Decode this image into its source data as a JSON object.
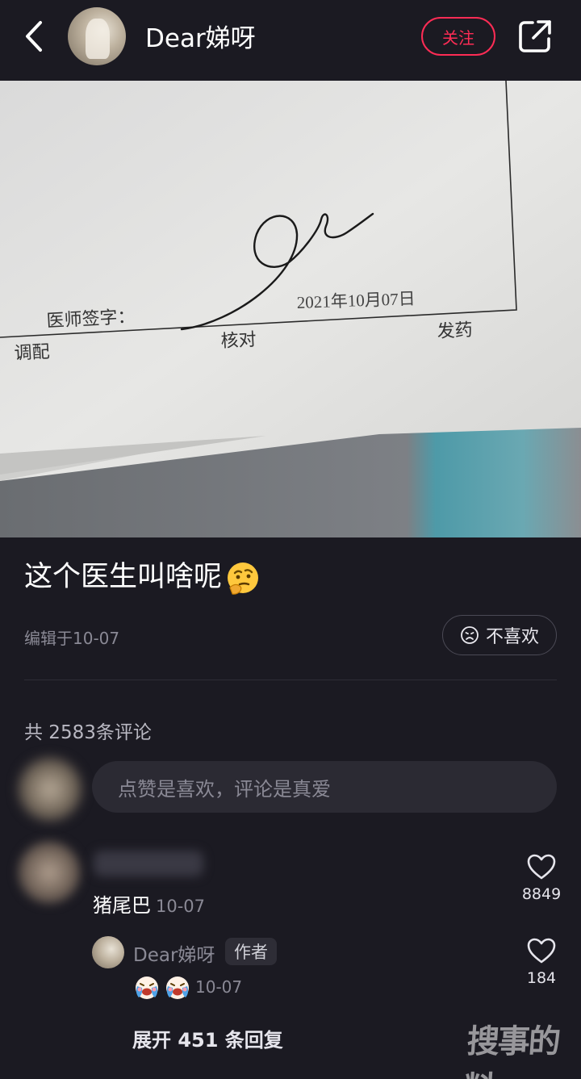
{
  "header": {
    "username": "Dear娣呀",
    "follow_label": "关注"
  },
  "photo": {
    "printed_date": "2021年10月07日",
    "label_signature": "医师签字：",
    "label_dispense": "调配",
    "label_check": "核对",
    "label_issue": "发药"
  },
  "post": {
    "title": "这个医生叫啥呢",
    "edited": "编辑于10-07",
    "dislike_label": "不喜欢"
  },
  "comments": {
    "count_label": "共 2583条评论",
    "input_placeholder": "点赞是喜欢，评论是真爱",
    "items": [
      {
        "text": "猪尾巴",
        "date": "10-07",
        "likes": "8849",
        "reply": {
          "name": "Dear娣呀",
          "tag": "作者",
          "date": "10-07",
          "likes": "184"
        }
      }
    ],
    "expand_label": "展开 451 条回复"
  },
  "watermark": "搜事的料",
  "icons": {
    "back": "chevron-left-icon",
    "share": "share-icon",
    "thinking_emoji": "thinking-face-emoji",
    "dislike": "frown-face-icon",
    "like": "heart-outline-icon",
    "crying_emoji": "crying-face-emoji"
  },
  "colors": {
    "background": "#1b1a22",
    "accent": "#fe2c55",
    "muted_text": "#8a8995",
    "input_bg": "#2b2a33"
  }
}
